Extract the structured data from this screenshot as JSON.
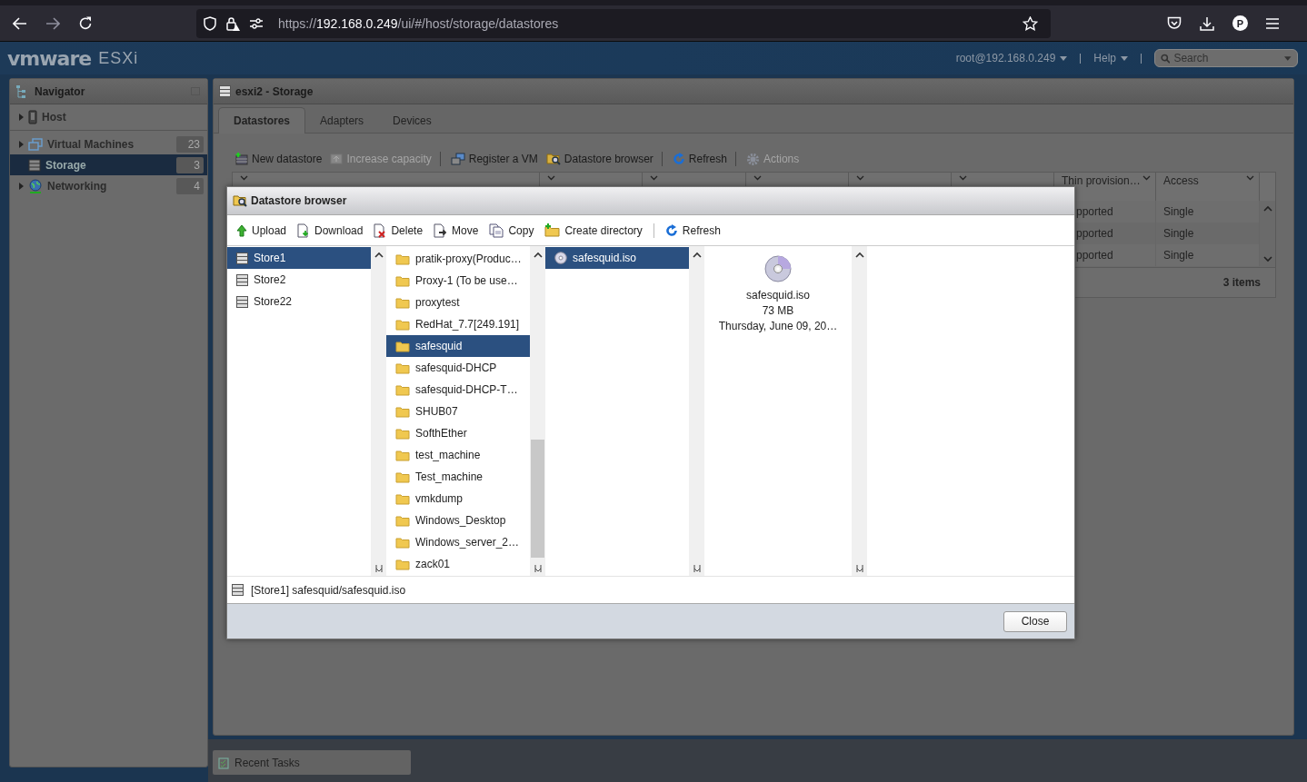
{
  "browser": {
    "url_scheme": "https://",
    "url_host": "192.168.0.249",
    "url_path": "/ui/#/host/storage/datastores",
    "profile_initial": "P"
  },
  "header": {
    "logo": "vmware",
    "product": "ESXi",
    "user": "root@192.168.0.249",
    "help": "Help",
    "search": {
      "placeholder": "Search"
    }
  },
  "navigator": {
    "title": "Navigator",
    "items": [
      {
        "label": "Host",
        "expandable": true,
        "selected": false
      },
      {
        "label": "Virtual Machines",
        "count": "23",
        "expandable": true,
        "selected": false
      },
      {
        "label": "Storage",
        "count": "3",
        "expandable": false,
        "selected": true
      },
      {
        "label": "Networking",
        "count": "4",
        "expandable": true,
        "selected": false
      }
    ]
  },
  "main": {
    "title": "esxi2 - Storage",
    "tabs": [
      {
        "label": "Datastores",
        "selected": true
      },
      {
        "label": "Adapters",
        "selected": false
      },
      {
        "label": "Devices",
        "selected": false
      }
    ],
    "toolbar": [
      {
        "label": "New datastore",
        "disabled": false
      },
      {
        "label": "Increase capacity",
        "disabled": true
      },
      {
        "label": "Register a VM",
        "disabled": false
      },
      {
        "label": "Datastore browser",
        "disabled": false
      },
      {
        "label": "Refresh",
        "disabled": false
      },
      {
        "label": "Actions",
        "disabled": true
      }
    ],
    "table": {
      "columns": [
        "Thin provision…",
        "Access"
      ],
      "rows": [
        [
          "pported",
          "Single"
        ],
        [
          "pported",
          "Single"
        ],
        [
          "pported",
          "Single"
        ]
      ],
      "footer": "3 items"
    }
  },
  "dialog": {
    "title": "Datastore browser",
    "toolbar": [
      {
        "label": "Upload"
      },
      {
        "label": "Download"
      },
      {
        "label": "Delete"
      },
      {
        "label": "Move"
      },
      {
        "label": "Copy"
      },
      {
        "label": "Create directory"
      },
      {
        "label": "Refresh"
      }
    ],
    "datastores": [
      {
        "name": "Store1",
        "selected": true
      },
      {
        "name": "Store2",
        "selected": false
      },
      {
        "name": "Store22",
        "selected": false
      }
    ],
    "folders": [
      {
        "name": "pratik-proxy(Produc…",
        "selected": false
      },
      {
        "name": "Proxy-1 (To be use…",
        "selected": false
      },
      {
        "name": "proxytest",
        "selected": false
      },
      {
        "name": "RedHat_7.7[249.191]",
        "selected": false
      },
      {
        "name": "safesquid",
        "selected": true
      },
      {
        "name": "safesquid-DHCP",
        "selected": false
      },
      {
        "name": "safesquid-DHCP-T…",
        "selected": false
      },
      {
        "name": "SHUB07",
        "selected": false
      },
      {
        "name": "SofthEther",
        "selected": false
      },
      {
        "name": "test_machine",
        "selected": false
      },
      {
        "name": "Test_machine",
        "selected": false
      },
      {
        "name": "vmkdump",
        "selected": false
      },
      {
        "name": "Windows_Desktop",
        "selected": false
      },
      {
        "name": "Windows_server_2…",
        "selected": false
      },
      {
        "name": "zack01",
        "selected": false
      }
    ],
    "files": [
      {
        "name": "safesquid.iso",
        "selected": true
      }
    ],
    "details": {
      "name": "safesquid.iso",
      "size": "73 MB",
      "date": "Thursday, June 09, 20…"
    },
    "path": "[Store1] safesquid/safesquid.iso",
    "close": "Close"
  },
  "recent_tasks": "Recent Tasks"
}
